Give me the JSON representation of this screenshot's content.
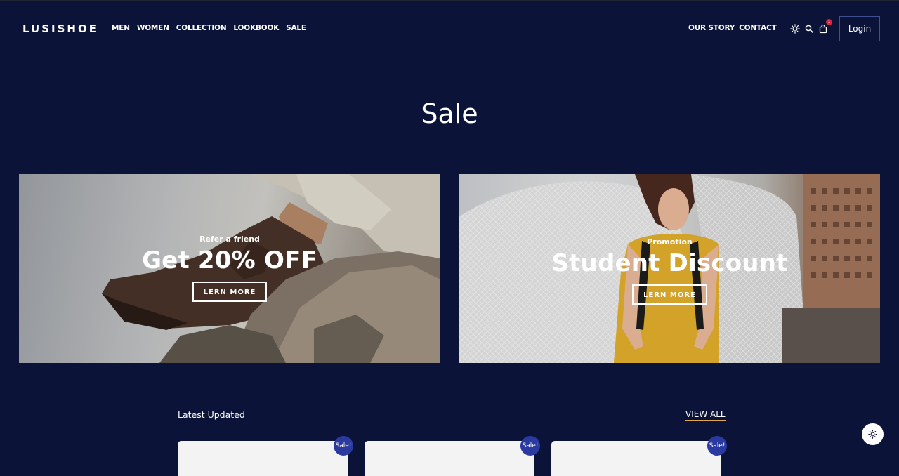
{
  "brand": "LUSISHOE",
  "nav": {
    "left": [
      "MEN",
      "WOMEN",
      "COLLECTION",
      "LOOKBOOK",
      "SALE"
    ],
    "right": [
      "OUR STORY",
      "CONTACT"
    ],
    "cart_count": "1",
    "login_label": "Login",
    "icons": [
      "sun-icon",
      "search-icon",
      "cart-icon"
    ]
  },
  "page": {
    "title": "Sale"
  },
  "banners": [
    {
      "eyebrow": "Refer a friend",
      "headline": "Get 20% OFF",
      "cta": "LERN MORE"
    },
    {
      "eyebrow": "Promotion",
      "headline": "Student Discount",
      "cta": "LERN MORE"
    }
  ],
  "latest": {
    "title": "Latest Updated",
    "view_all": "VIEW ALL",
    "cards": [
      {
        "tag": "Sale!"
      },
      {
        "tag": "Sale!"
      },
      {
        "tag": "Sale!"
      }
    ]
  },
  "colors": {
    "background": "#0b1338",
    "sale_tag": "#2a3aa0",
    "view_all_underline": "#e2a44c",
    "badge": "#e0213a"
  }
}
